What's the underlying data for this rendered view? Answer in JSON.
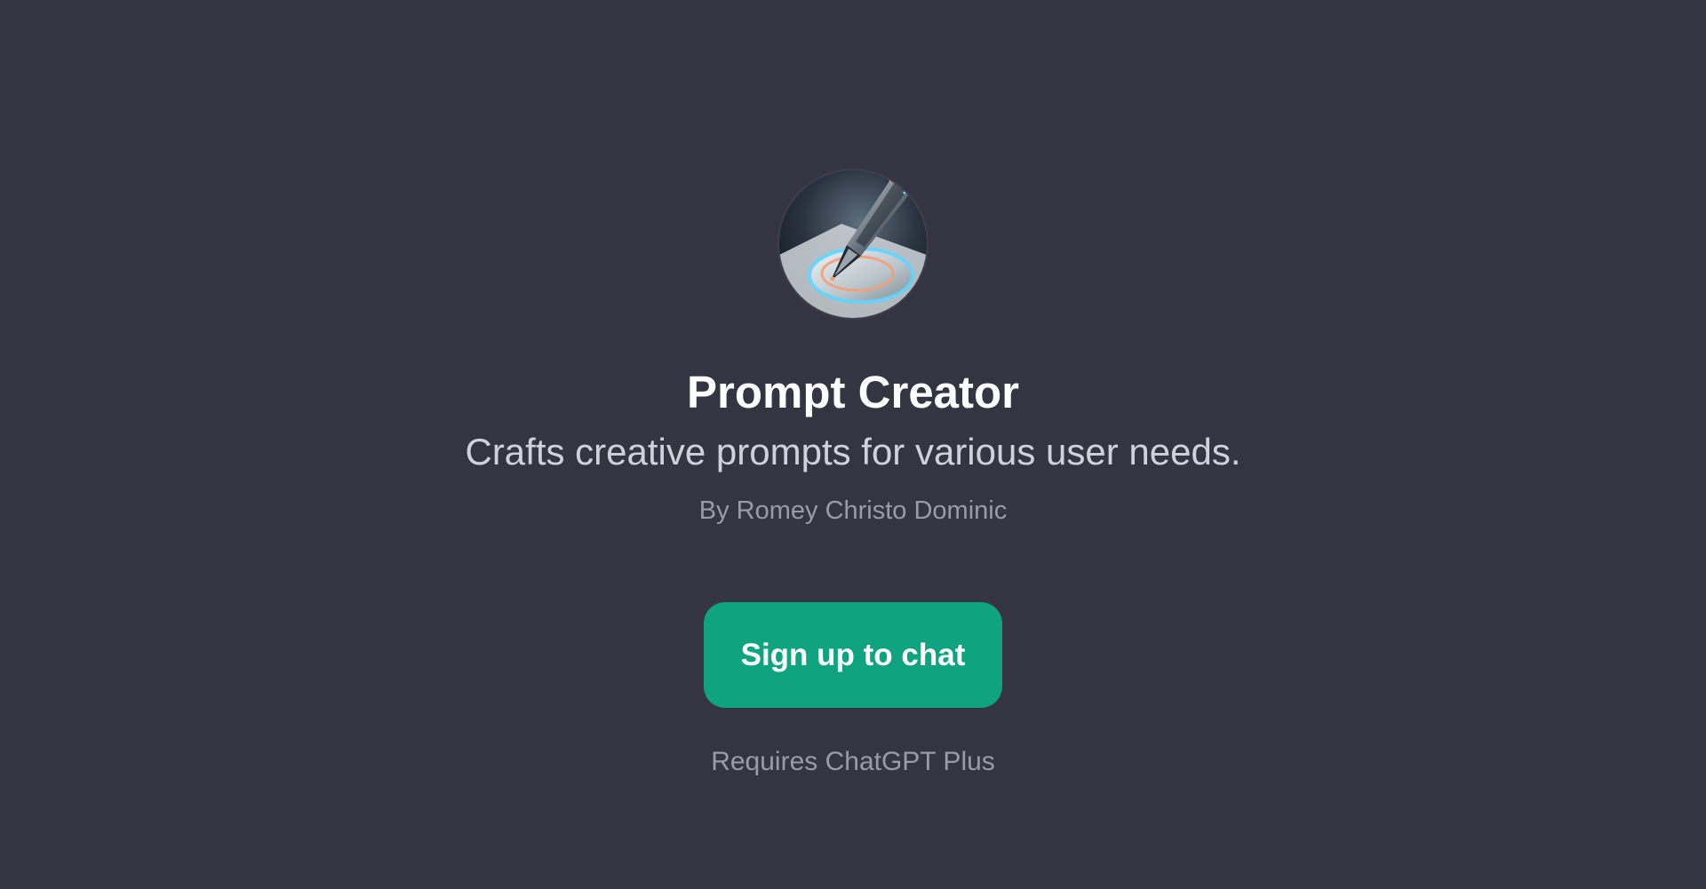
{
  "gpt": {
    "icon": "pen-nib-icon",
    "title": "Prompt Creator",
    "description": "Crafts creative prompts for various user needs.",
    "author": "By Romey Christo Dominic"
  },
  "cta": {
    "label": "Sign up to chat",
    "note": "Requires ChatGPT Plus"
  },
  "colors": {
    "background": "#343541",
    "accent": "#10a37f",
    "title": "#ffffff",
    "subtitle": "#d1d1db",
    "muted": "#9b9ba8"
  }
}
